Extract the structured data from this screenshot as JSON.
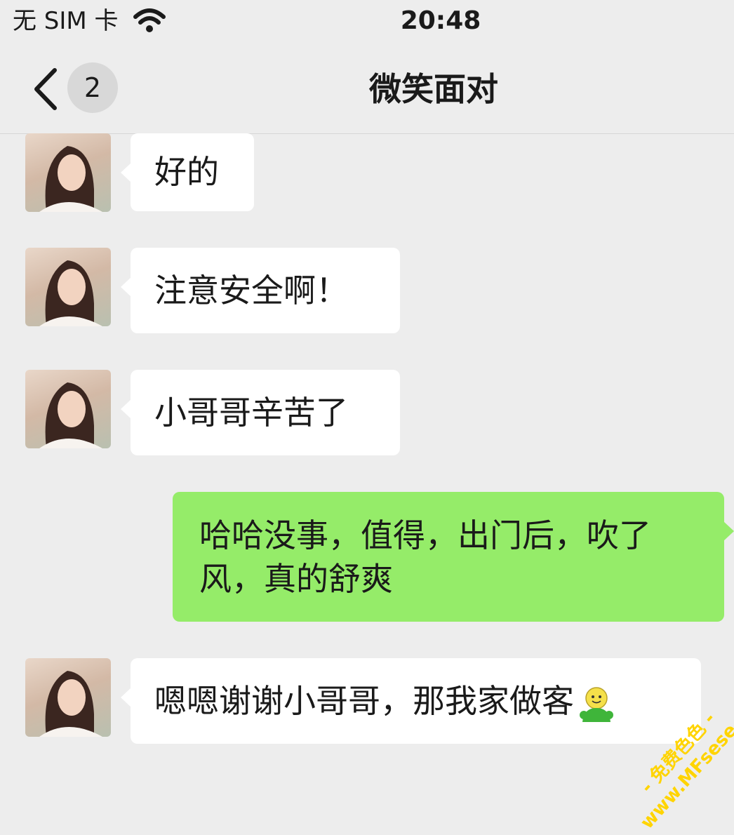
{
  "status_bar": {
    "carrier": "无 SIM 卡",
    "time": "20:48",
    "icons": [
      "wifi-icon"
    ]
  },
  "nav": {
    "unread_count": "2",
    "title": "微笑面对",
    "icons": [
      "back-chevron-icon"
    ]
  },
  "messages": [
    {
      "side": "received",
      "text": "好的"
    },
    {
      "side": "received",
      "text": "注意安全啊！"
    },
    {
      "side": "received",
      "text": "小哥哥辛苦了"
    },
    {
      "side": "sent",
      "text": "哈哈没事，值得，出门后，吹了风，真的舒爽"
    },
    {
      "side": "received",
      "text": "嗯嗯谢谢小哥哥，那我家做客",
      "emoji": "smiley-emoji-icon"
    }
  ],
  "watermark": {
    "line1": "- 免费色色 -",
    "line2": "www.MFsese.com"
  },
  "colors": {
    "background": "#ededed",
    "received_bubble": "#ffffff",
    "sent_bubble": "#95ec69",
    "badge": "#d8d8d8",
    "watermark": "#ffd400"
  }
}
